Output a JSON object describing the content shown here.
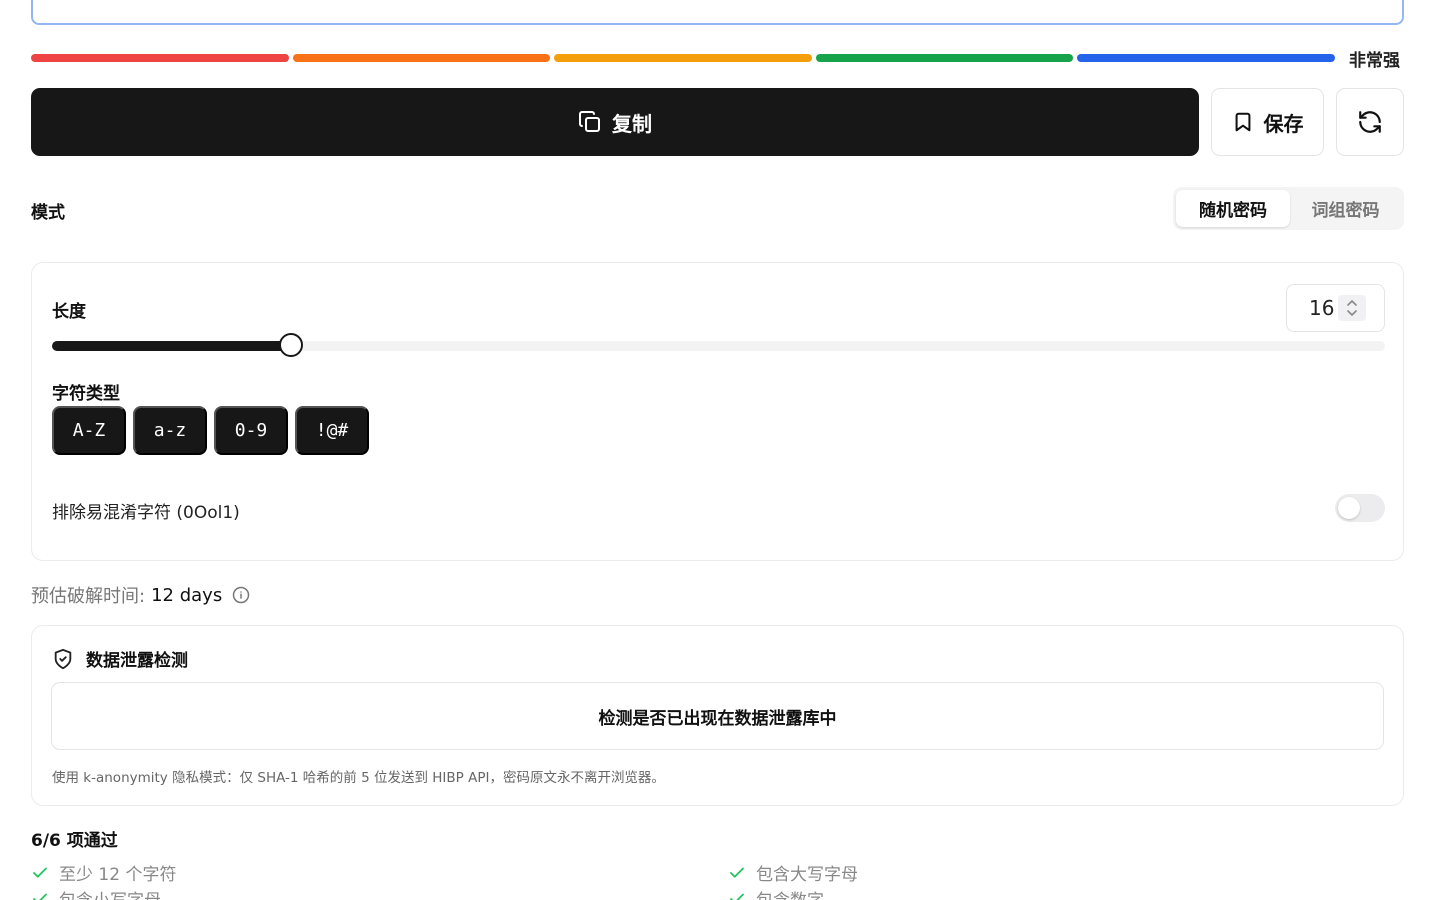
{
  "strength": {
    "label": "非常强",
    "segment_colors": [
      "#ef4444",
      "#f97316",
      "#f59e0b",
      "#16a34a",
      "#2563eb"
    ]
  },
  "actions": {
    "copy_label": "复制",
    "save_label": "保存"
  },
  "mode": {
    "label": "模式",
    "tabs": [
      {
        "label": "随机密码",
        "active": true
      },
      {
        "label": "词组密码",
        "active": false
      }
    ]
  },
  "settings": {
    "length_label": "长度",
    "length_value": "16",
    "length_fraction": 0.179,
    "char_types_label": "字符类型",
    "char_types": [
      {
        "label": "A-Z",
        "enabled": true
      },
      {
        "label": "a-z",
        "enabled": true
      },
      {
        "label": "0-9",
        "enabled": true
      },
      {
        "label": "!@#",
        "enabled": true
      }
    ],
    "exclude_label": "排除易混淆字符 (0Ool1)",
    "exclude_enabled": false
  },
  "crack_time": {
    "label": "预估破解时间:",
    "value": "12 days"
  },
  "breach": {
    "title": "数据泄露检测",
    "button_label": "检测是否已出现在数据泄露库中",
    "note": "使用 k-anonymity 隐私模式：仅 SHA-1 哈希的前 5 位发送到 HIBP API，密码原文永不离开浏览器。"
  },
  "checks": {
    "title": "6/6 项通过",
    "items": [
      {
        "label": "至少 12 个字符"
      },
      {
        "label": "包含大写字母"
      },
      {
        "label": "包含小写字母"
      },
      {
        "label": "包含数字"
      }
    ]
  },
  "colors": {
    "accent_dark": "#171717",
    "check_green": "#22c55e"
  }
}
